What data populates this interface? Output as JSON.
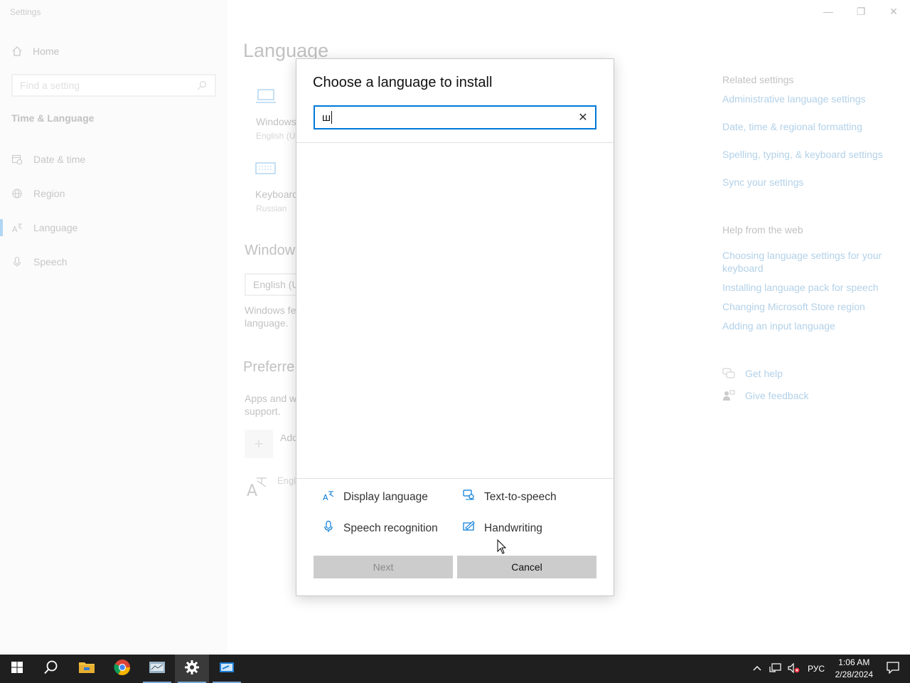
{
  "window": {
    "app_title": "Settings",
    "controls": {
      "minimize": "—",
      "maximize": "❐",
      "close": "✕"
    }
  },
  "sidebar": {
    "home_label": "Home",
    "search_placeholder": "Find a setting",
    "section_title": "Time & Language",
    "items": [
      {
        "label": "Date & time",
        "icon": "calendar-clock-icon"
      },
      {
        "label": "Region",
        "icon": "globe-icon"
      },
      {
        "label": "Language",
        "icon": "language-icon",
        "active": true
      },
      {
        "label": "Speech",
        "icon": "microphone-icon"
      }
    ]
  },
  "main": {
    "page_title": "Language",
    "windows_display_label": "Windows",
    "windows_display_sub": "English (U",
    "keyboard_label": "Keyboard",
    "keyboard_sub": "Russian",
    "windows_display_heading": "Window",
    "display_dropdown_value": "English (U",
    "windows_features_text_1": "Windows fe",
    "windows_features_text_2": "language.",
    "preferred_heading": "Preferre",
    "apps_text_1": "Apps and w",
    "apps_text_2": "support.",
    "add_label": "Add",
    "english_item": "Engl"
  },
  "related": {
    "heading": "Related settings",
    "links": [
      "Administrative language settings",
      "Date, time & regional formatting",
      "Spelling, typing, & keyboard settings",
      "Sync your settings"
    ],
    "help_heading": "Help from the web",
    "help_links": [
      "Choosing language settings for your",
      "keyboard",
      "Installing language pack for speech",
      "Changing Microsoft Store region",
      "Adding an input language"
    ],
    "get_help": "Get help",
    "give_feedback": "Give feedback"
  },
  "dialog": {
    "title": "Choose a language to install",
    "search_value": "ш",
    "legend": [
      {
        "label": "Display language",
        "icon": "display-language-icon"
      },
      {
        "label": "Text-to-speech",
        "icon": "text-to-speech-icon"
      },
      {
        "label": "Speech recognition",
        "icon": "speech-recognition-icon"
      },
      {
        "label": "Handwriting",
        "icon": "handwriting-icon"
      }
    ],
    "next_label": "Next",
    "cancel_label": "Cancel"
  },
  "taskbar": {
    "tray_lang": "РУС",
    "time": "1:06 AM",
    "date": "2/28/2024"
  },
  "colors": {
    "accent": "#0078d7",
    "link": "#0066b4",
    "taskbar": "#1f1f1f"
  }
}
